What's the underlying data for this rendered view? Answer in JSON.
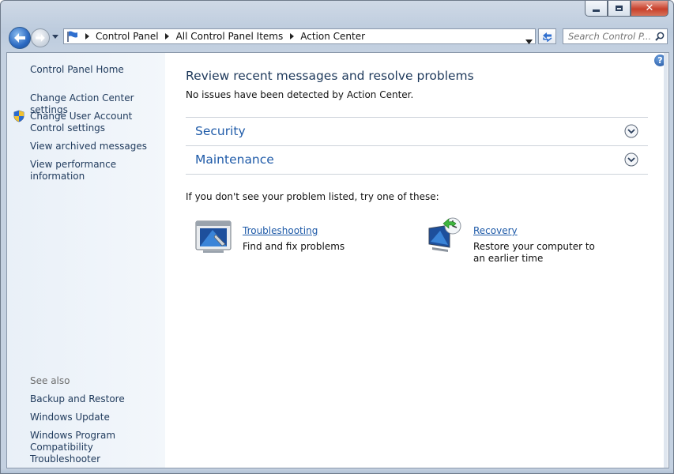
{
  "breadcrumb": [
    "Control Panel",
    "All Control Panel Items",
    "Action Center"
  ],
  "search": {
    "placeholder": "Search Control P..."
  },
  "left_pane": {
    "home": "Control Panel Home",
    "links": [
      "Change Action Center settings",
      "Change User Account Control settings",
      "View archived messages",
      "View performance information"
    ],
    "see_also_label": "See also",
    "see_also": [
      "Backup and Restore",
      "Windows Update",
      "Windows Program Compatibility Troubleshooter"
    ]
  },
  "main": {
    "heading": "Review recent messages and resolve problems",
    "status": "No issues have been detected by Action Center.",
    "sections": [
      "Security",
      "Maintenance"
    ],
    "hint": "If you don't see your problem listed, try one of these:",
    "tools": [
      {
        "title": "Troubleshooting",
        "description": "Find and fix problems"
      },
      {
        "title": "Recovery",
        "description": "Restore your computer to an earlier time"
      }
    ]
  },
  "colors": {
    "link": "#1e5aa8",
    "heading": "#1e395b",
    "leftpane": "#e9f0f8"
  }
}
